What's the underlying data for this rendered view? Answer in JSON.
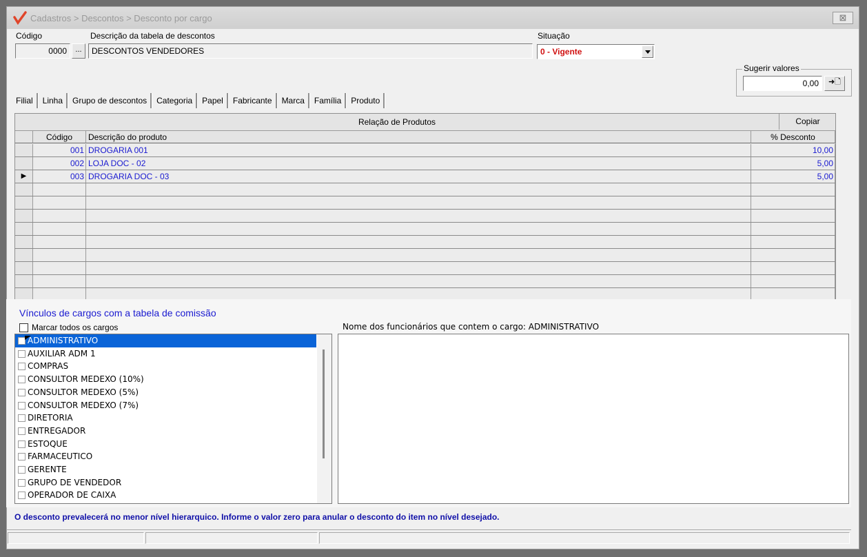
{
  "window": {
    "title": "Cadastros > Descontos > Desconto por cargo",
    "close_symbol": "⊠",
    "logo_icon": "check-logo-icon"
  },
  "header": {
    "codigo_label": "Código",
    "codigo_value": "0000",
    "lookup_label": "...",
    "descricao_label": "Descrição da tabela de descontos",
    "descricao_value": "DESCONTOS VENDEDORES",
    "situacao_label": "Situação",
    "situacao_value": "0 - Vigente"
  },
  "sugerir": {
    "label": "Sugerir valores",
    "value": "0,00",
    "apply_label": "➜🗋"
  },
  "tabs": [
    "Filial",
    "Linha",
    "Grupo de descontos",
    "Categoria",
    "Papel",
    "Fabricante",
    "Marca",
    "Família",
    "Produto"
  ],
  "grid": {
    "title": "Relação de Produtos",
    "copy_label": "Copiar",
    "columns": {
      "codigo": "Código",
      "descricao": "Descrição do produto",
      "desconto": "% Desconto"
    },
    "rows": [
      {
        "codigo": "001",
        "descricao": "DROGARIA 001",
        "desconto": "10,00"
      },
      {
        "codigo": "002",
        "descricao": "LOJA  DOC - 02",
        "desconto": "5,00"
      },
      {
        "codigo": "003",
        "descricao": "DROGARIA DOC - 03",
        "desconto": "5,00"
      }
    ],
    "current_row_marker": "▶"
  },
  "vinculos": {
    "title": "Vínculos de cargos com a tabela de comissão",
    "marcar_label": "Marcar todos os cargos",
    "cargos": [
      "ADMINISTRATIVO",
      "AUXILIAR ADM 1",
      "COMPRAS",
      "CONSULTOR MEDEXO (10%)",
      "CONSULTOR MEDEXO (5%)",
      "CONSULTOR MEDEXO (7%)",
      "DIRETORIA",
      "ENTREGADOR",
      "ESTOQUE",
      "FARMACEUTICO",
      "GERENTE",
      "GRUPO DE VENDEDOR",
      "OPERADOR DE CAIXA"
    ],
    "funcionarios_title": "Nome dos funcionários que contem o cargo: ADMINISTRATIVO"
  },
  "footer_note": "O desconto prevalecerá no menor nível hierarquico. Informe o valor zero para anular o desconto do item no nível desejado.",
  "colors": {
    "accent_blue": "#1a1ad0",
    "situacao_red": "#d01010",
    "selection": "#0a64d8"
  }
}
